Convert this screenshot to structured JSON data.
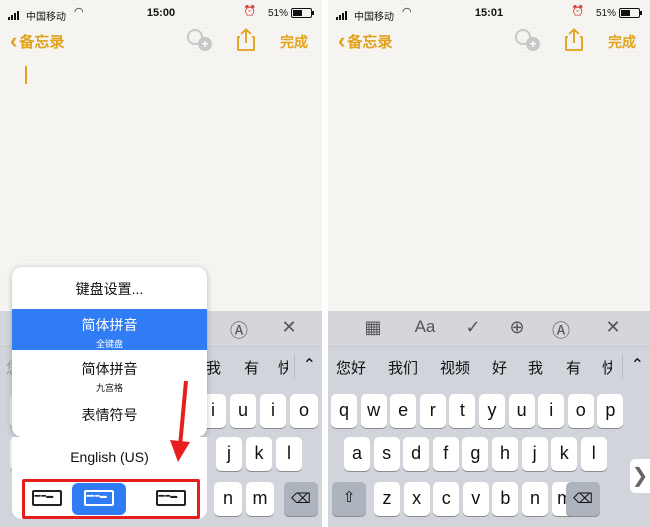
{
  "left": {
    "status": {
      "carrier": "中国移动",
      "time": "15:00",
      "battery": "51%",
      "battery_level": 0.51
    },
    "nav": {
      "back_label": "备忘录",
      "done_label": "完成"
    },
    "candidates": [
      "您好",
      "我",
      "好",
      "我",
      "有",
      "快"
    ],
    "popup": {
      "settings": "键盘设置...",
      "items": [
        {
          "main": "简体拼音",
          "sub": "全键盘",
          "selected": true
        },
        {
          "main": "简体拼音",
          "sub": "九宫格",
          "selected": false
        },
        {
          "main": "表情符号",
          "sub": "",
          "selected": false
        },
        {
          "main": "English (US)",
          "sub": "",
          "selected": false
        }
      ]
    },
    "visible_keys": {
      "row1": [
        "q",
        "w",
        "i",
        "u",
        "i",
        "o",
        "p"
      ],
      "row2": [
        "a",
        "j",
        "k",
        "l"
      ],
      "row3": [
        "n",
        "m"
      ]
    }
  },
  "right": {
    "status": {
      "carrier": "中国移动",
      "time": "15:01",
      "battery": "51%",
      "battery_level": 0.51
    },
    "nav": {
      "back_label": "备忘录",
      "done_label": "完成"
    },
    "toolbar": {
      "aa_label": "Aa"
    },
    "candidates": [
      "您好",
      "我们",
      "视频",
      "好",
      "我",
      "有",
      "快"
    ],
    "rows": {
      "row1": [
        "q",
        "w",
        "e",
        "r",
        "t",
        "y",
        "u",
        "i",
        "o",
        "p"
      ],
      "row2": [
        "a",
        "s",
        "d",
        "f",
        "g",
        "h",
        "j",
        "k",
        "l"
      ],
      "row3": [
        "z",
        "x",
        "c",
        "v",
        "b",
        "n",
        "m"
      ]
    }
  },
  "colors": {
    "accent": "#e2a21b",
    "selection_blue": "#2f7cf5",
    "annotation_red": "#e61e1e"
  }
}
